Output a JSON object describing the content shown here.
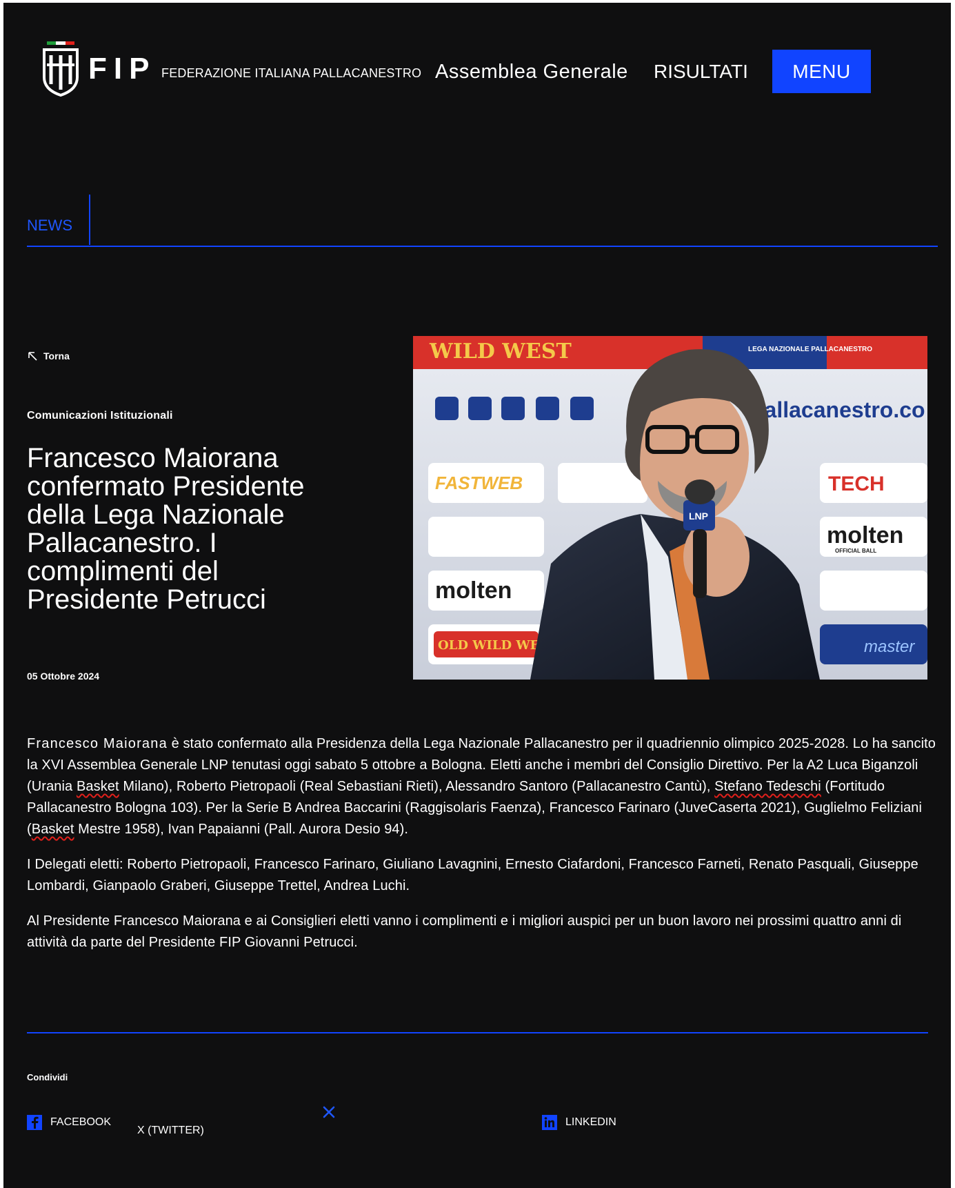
{
  "header": {
    "logo_text": "FIP",
    "federation_name": "FEDERAZIONE ITALIANA PALLACANESTRO",
    "nav_assembly": "Assemblea Generale",
    "nav_results": "RISULTATI",
    "menu_label": "MENU"
  },
  "section_tab": "NEWS",
  "article": {
    "back_label": "Torna",
    "category": "Comunicazioni Istituzionali",
    "title": "Francesco Maiorana confermato Presidente della Lega Nazionale Pallacanestro. I complimenti del Presidente Petrucci",
    "date": "05 Ottobre 2024",
    "body": {
      "p1_name": "Francesco Maiorana",
      "p1_a": " è stato confermato alla Presidenza della Lega Nazionale Pallacanestro per il quadriennio olimpico 2025-2028. Lo ha sancito la XVI Assemblea Generale LNP tenutasi oggi sabato 5 ottobre a Bologna. Eletti anche i membri del Consiglio Direttivo. Per la A2 Luca Biganzoli (Urania ",
      "p1_w1": "Basket",
      "p1_b": " Milano), Roberto Pietropaoli (Real Sebastiani Rieti), Alessandro Santoro (Pallacanestro Cantù), ",
      "p1_w2": "Stefano Tedeschi",
      "p1_c": " (Fortitudo Pallacanestro Bologna 103). Per la Serie B Andrea Baccarini (Raggisolaris Faenza), Francesco Farinaro (JuveCaserta 2021), Guglielmo Feliziani (",
      "p1_w3": "Basket",
      "p1_d": " Mestre 1958), Ivan Papaianni (Pall. Aurora Desio 94).",
      "p2": "I Delegati eletti: Roberto Pietropaoli, Francesco Farinaro, Giuliano Lavagnini, Ernesto Ciafardoni, Francesco Farneti, Renato Pasquali, Giuseppe Lombardi, Gianpaolo Graberi, Giuseppe Trettel, Andrea Luchi.",
      "p3": "Al Presidente Francesco Maiorana e ai Consiglieri eletti vanno i complimenti e i migliori auspici per un buon lavoro nei prossimi quattro anni di attività da parte del Presidente FIP Giovanni Petrucci."
    }
  },
  "hero_image": {
    "banner_top_left": "WILD WEST",
    "banner_top_right": "LEGA NAZIONALE PALLACANESTRO",
    "website_text": "pallacanestro.co",
    "sponsor_fast": "FASTWEB",
    "sponsor_tech": "TECH",
    "sponsor_molten": "molten",
    "sponsor_molten_sub": "OFFICIAL BALL",
    "sponsor_oldwild": "OLD WILD WEST",
    "sponsor_master": "master",
    "mic_label": "LNP"
  },
  "share": {
    "label": "Condividi",
    "facebook": "FACEBOOK",
    "twitter": "X (TWITTER)",
    "linkedin": "LINKEDIN"
  },
  "colors": {
    "background": "#0f0f10",
    "accent_blue": "#1144ff",
    "text": "#ffffff",
    "spell_underline": "#e0201b"
  }
}
